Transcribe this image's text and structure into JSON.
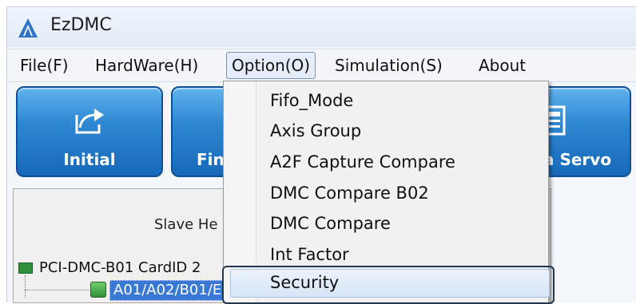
{
  "window": {
    "title": "EzDMC"
  },
  "menubar": {
    "items": [
      {
        "label": "File(F)"
      },
      {
        "label": "HardWare(H)"
      },
      {
        "label": "Option(O)"
      },
      {
        "label": "Simulation(S)"
      },
      {
        "label": "About"
      }
    ]
  },
  "toolbar": {
    "buttons": [
      {
        "label": "Initial",
        "icon": "export-icon"
      },
      {
        "label": "Fin",
        "icon": "button-icon"
      },
      {
        "label": "a Servo",
        "icon": "servo-icon"
      }
    ]
  },
  "panel": {
    "slave_label": "Slave He",
    "tree": {
      "card": "PCI-DMC-B01 CardID 2",
      "selected_node": "A01/A02/B01/E"
    }
  },
  "option_menu": {
    "items": [
      {
        "label": "Fifo_Mode"
      },
      {
        "label": "Axis Group"
      },
      {
        "label": "A2F Capture  Compare"
      },
      {
        "label": "DMC Compare B02"
      },
      {
        "label": "DMC Compare"
      },
      {
        "label": "Int Factor"
      },
      {
        "label": "Security"
      }
    ],
    "highlighted": "Security"
  },
  "colors": {
    "toolbar_blue": "#1f78c8",
    "selection_blue": "#3a78d6",
    "menu_highlight": "#1f3550"
  }
}
